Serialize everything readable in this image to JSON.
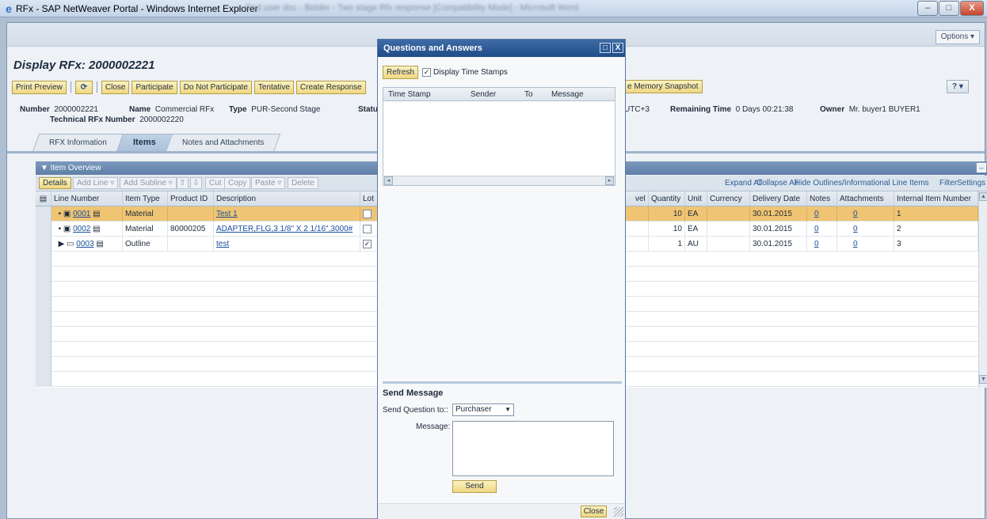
{
  "window": {
    "title": "RFx - SAP NetWeaver Portal - Windows Internet Explorer",
    "background_title": "End user doc - Bidder - Two stage Rfx response [Compatibility Mode] - Microsoft Word",
    "btn_min": "–",
    "btn_max": "□",
    "btn_close": "X"
  },
  "portal": {
    "options_label": "Options ▾"
  },
  "page": {
    "title": "Display RFx: 2000002221"
  },
  "toolbar": {
    "print_preview": "Print Preview",
    "refresh_icon": "⟳",
    "close": "Close",
    "participate": "Participate",
    "do_not_participate": "Do Not Participate",
    "tentative": "Tentative",
    "create_response": "Create Response",
    "memory_snapshot": "e Memory Snapshot",
    "help_icon": "? ▾"
  },
  "header_info": {
    "number_label": "Number",
    "number_value": "2000002221",
    "name_label": "Name",
    "name_value": "Commercial RFx",
    "type_label": "Type",
    "type_value": "PUR-Second Stage",
    "status_label": "Statu",
    "tz_value": "UTC+3",
    "remaining_label": "Remaining Time",
    "remaining_value": "0 Days 00:21:38",
    "owner_label": "Owner",
    "owner_value": "Mr. buyer1 BUYER1",
    "tech_label": "Technical RFx Number",
    "tech_value": "2000002220"
  },
  "tabs": [
    {
      "label": "RFX Information"
    },
    {
      "label": "Items"
    },
    {
      "label": "Notes and Attachments"
    }
  ],
  "item_panel": {
    "title": "▼ Item Overview",
    "collapse_icon": "–"
  },
  "item_toolbar": {
    "details": "Details",
    "add_line": "Add Line ▿",
    "add_subline": "Add Subline ▿",
    "up_icon": "⇧",
    "down_icon": "⇩",
    "cut": "Cut",
    "copy": "Copy",
    "paste": "Paste ▿",
    "delete": "Delete",
    "expand_all": "Expand All",
    "collapse_all": "Collapse All",
    "hide_outlines": "Hide Outlines/Informational Line Items",
    "filter": "Filter",
    "settings": "Settings"
  },
  "grid": {
    "select_all_icon": "▤",
    "columns": {
      "line_number": "Line Number",
      "item_type": "Item Type",
      "product_id": "Product ID",
      "description": "Description",
      "lot": "Lot",
      "level": "vel",
      "quantity": "Quantity",
      "unit": "Unit",
      "currency": "Currency",
      "delivery_date": "Delivery Date",
      "notes": "Notes",
      "attachments": "Attachments",
      "internal_item_number": "Internal Item Number"
    },
    "rows": [
      {
        "bullet": "•",
        "icon": "▣",
        "line": "0001",
        "detail_icon": "▤",
        "item_type": "Material",
        "product_id": "",
        "description": "Test 1",
        "lot": "",
        "quantity": "10",
        "unit": "EA",
        "currency": "",
        "delivery_date": "30.01.2015",
        "notes": "0",
        "attachments": "0",
        "internal": "1"
      },
      {
        "bullet": "•",
        "icon": "▣",
        "line": "0002",
        "detail_icon": "▤",
        "item_type": "Material",
        "product_id": "80000205",
        "description": "ADAPTER,FLG,3 1/8\" X 2 1/16\",3000#",
        "lot": "",
        "quantity": "10",
        "unit": "EA",
        "currency": "",
        "delivery_date": "30.01.2015",
        "notes": "0",
        "attachments": "0",
        "internal": "2"
      },
      {
        "bullet": "▶",
        "icon": "▭",
        "line": "0003",
        "detail_icon": "▤",
        "item_type": "Outline",
        "product_id": "",
        "description": "test",
        "lot": "✓",
        "quantity": "1",
        "unit": "AU",
        "currency": "",
        "delivery_date": "30.01.2015",
        "notes": "0",
        "attachments": "0",
        "internal": "3"
      }
    ],
    "scroll_up": "▲",
    "scroll_down": "▼"
  },
  "qa_dialog": {
    "title": "Questions and Answers",
    "max_icon": "□",
    "close_icon": "X",
    "refresh": "Refresh",
    "timestamps_check": "✓",
    "timestamps_label": "Display Time Stamps",
    "columns": {
      "time_stamp": "Time Stamp",
      "sender": "Sender",
      "to": "To",
      "message": "Message"
    },
    "scroll_left": "◂",
    "scroll_right": "▸",
    "send_header": "Send Message",
    "send_to_label": "Send Question to::",
    "send_to_value": "Purchaser",
    "dropdown_icon": "▼",
    "message_label": "Message:",
    "send": "Send",
    "close": "Close"
  }
}
